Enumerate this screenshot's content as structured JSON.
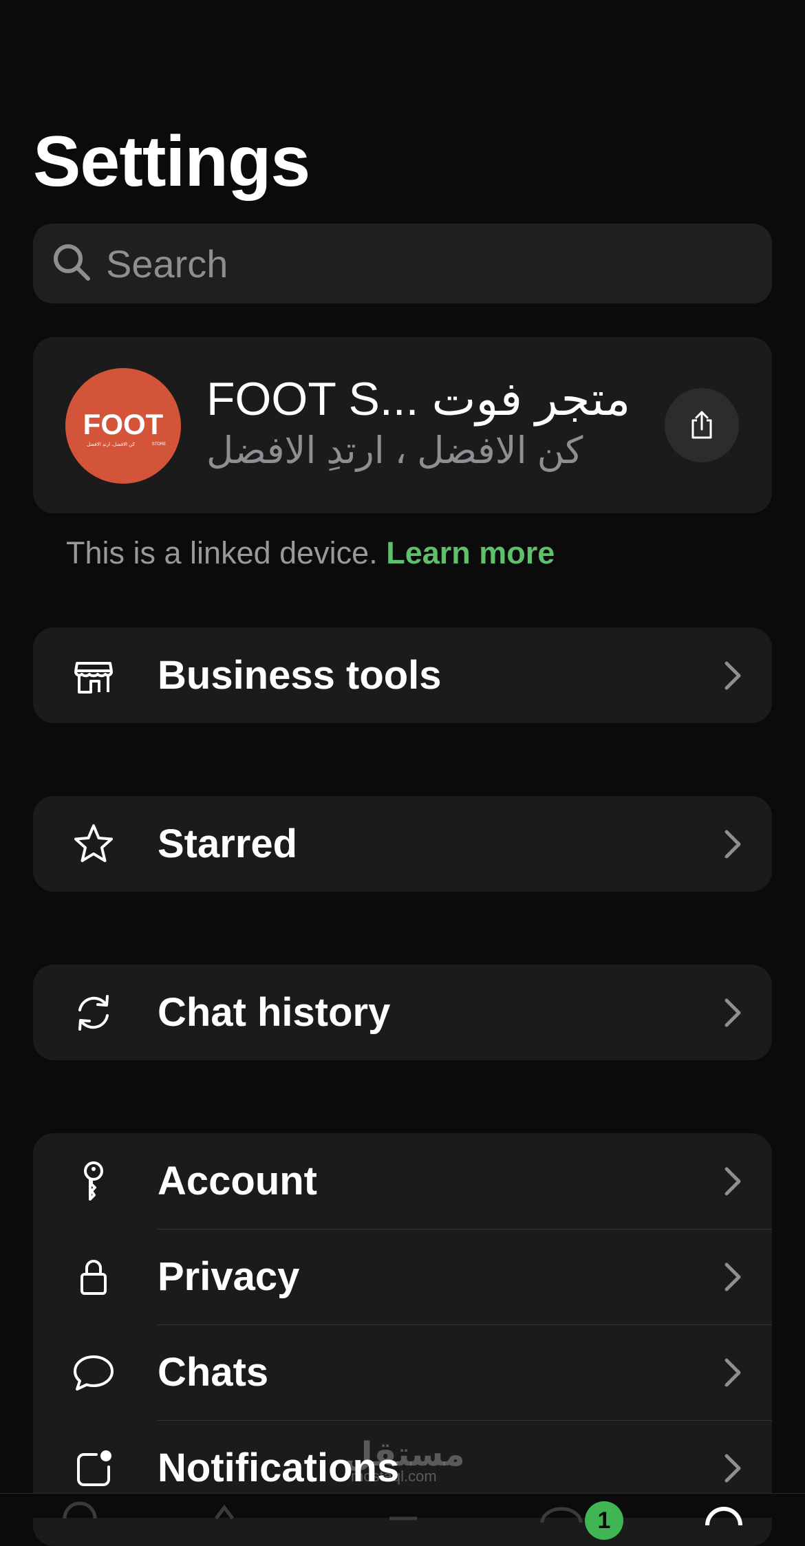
{
  "header": {
    "title": "Settings"
  },
  "search": {
    "placeholder": "Search"
  },
  "profile": {
    "name": "FOOT S... متجر فوت",
    "status": "كن الافضل ، ارتدِ الافضل",
    "avatar_text": "FOOT",
    "avatar_subtext": "كن الافضل، ارتدِ الافضل",
    "avatar_store_text": "STORE",
    "avatar_color": "#d4543a"
  },
  "linked_device": {
    "text": "This is a linked device.",
    "link": "Learn more",
    "link_color": "#5fbf6b"
  },
  "groups": [
    {
      "items": [
        {
          "label": "Business tools",
          "icon": "storefront-icon"
        }
      ]
    },
    {
      "items": [
        {
          "label": "Starred",
          "icon": "star-icon"
        }
      ]
    },
    {
      "items": [
        {
          "label": "Chat history",
          "icon": "sync-icon"
        }
      ]
    },
    {
      "items": [
        {
          "label": "Account",
          "icon": "key-icon"
        },
        {
          "label": "Privacy",
          "icon": "lock-icon"
        },
        {
          "label": "Chats",
          "icon": "chat-bubble-icon"
        },
        {
          "label": "Notifications",
          "icon": "notification-icon"
        }
      ]
    }
  ],
  "watermark": {
    "text": "مستقل",
    "sub": "mostaql.com"
  },
  "tab_bar": {
    "badge": "1"
  }
}
